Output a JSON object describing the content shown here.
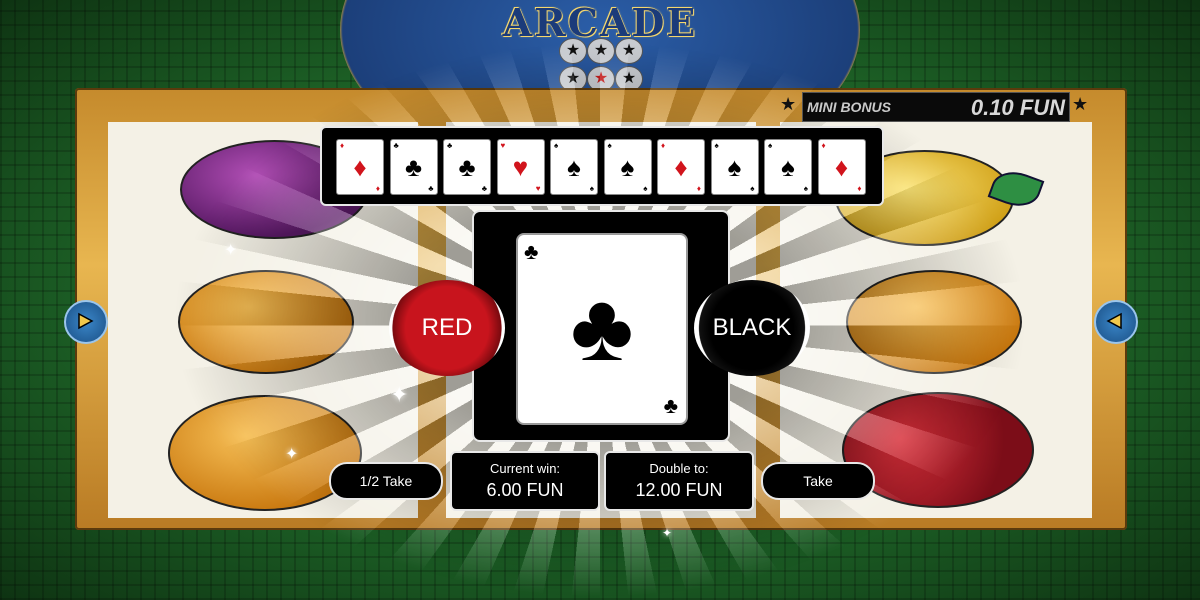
{
  "game": {
    "title": "ARCADE",
    "logo_stars": [
      "★",
      "★",
      "★",
      "★",
      "★",
      "★",
      "★",
      "★",
      "★"
    ]
  },
  "mini_bonus": {
    "label": "MINI BONUS",
    "value": "0.10 FUN"
  },
  "history": {
    "cards": [
      {
        "suit": "♦",
        "color": "red"
      },
      {
        "suit": "♣",
        "color": "black"
      },
      {
        "suit": "♣",
        "color": "black"
      },
      {
        "suit": "♥",
        "color": "red"
      },
      {
        "suit": "♠",
        "color": "black"
      },
      {
        "suit": "♠",
        "color": "black"
      },
      {
        "suit": "♦",
        "color": "red"
      },
      {
        "suit": "♠",
        "color": "black"
      },
      {
        "suit": "♠",
        "color": "black"
      },
      {
        "suit": "♦",
        "color": "red"
      }
    ]
  },
  "current_card": {
    "suit": "♣",
    "color": "black"
  },
  "buttons": {
    "red_label": "RED",
    "black_label": "BLACK",
    "half_take_label": "1/2 Take",
    "take_label": "Take"
  },
  "win": {
    "current_label": "Current win:",
    "current_value": "6.00 FUN",
    "double_label": "Double to:",
    "double_value": "12.00 FUN"
  },
  "colors": {
    "red_button": "#c8141d",
    "black_button": "#000000",
    "background": "#1a5a24"
  }
}
